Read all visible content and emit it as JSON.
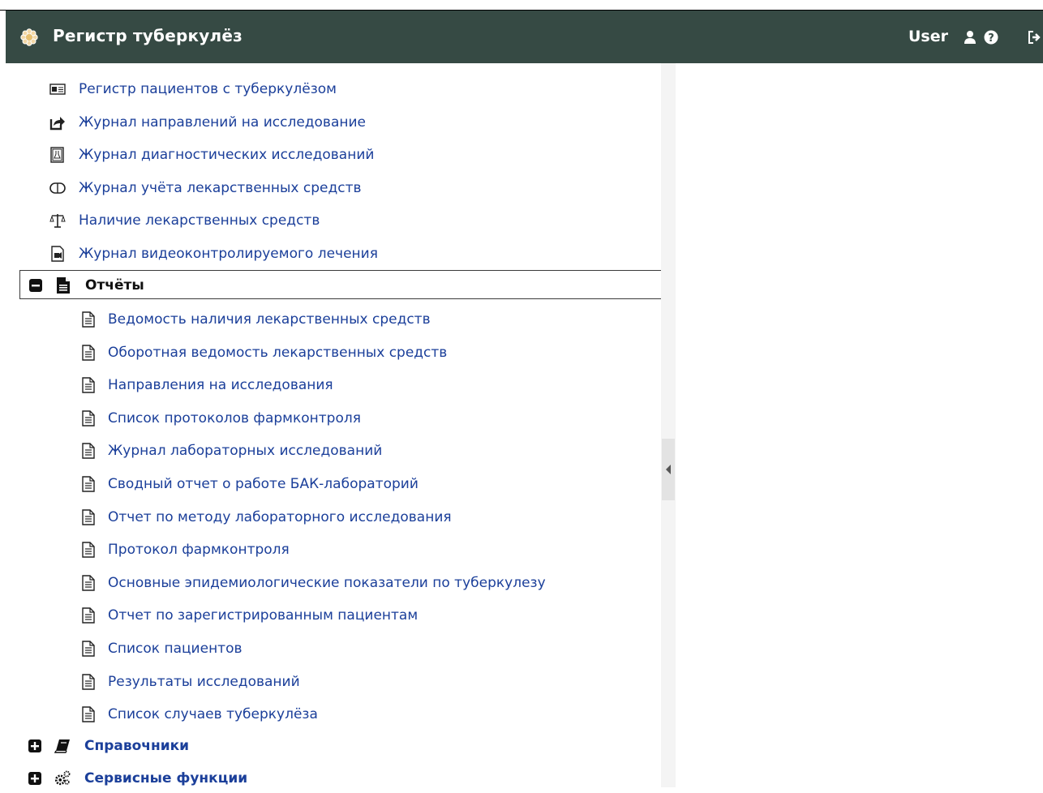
{
  "header": {
    "title": "Регистр туберкулёз",
    "user": "User",
    "bg_color": "#364a44",
    "icons": [
      "flower-logo-icon",
      "user-icon",
      "help-icon",
      "logout-icon"
    ]
  },
  "menu": {
    "top_items": [
      {
        "label": "Регистр пациентов с туберкулёзом",
        "icon": "id-card-icon"
      },
      {
        "label": "Журнал направлений на исследование",
        "icon": "share-icon"
      },
      {
        "label": "Журнал диагностических исследований",
        "icon": "lab-flask-icon"
      },
      {
        "label": "Журнал учёта лекарственных средств",
        "icon": "pill-capsule-icon"
      },
      {
        "label": "Наличие лекарственных средств",
        "icon": "scales-icon"
      },
      {
        "label": "Журнал видеоконтролируемого лечения",
        "icon": "video-file-icon"
      }
    ],
    "reports": {
      "label": "Отчёты",
      "expanded": true,
      "items": [
        "Ведомость наличия лекарственных средств",
        "Оборотная ведомость лекарственных средств",
        "Направления на исследования",
        "Список протоколов фармконтроля",
        "Журнал лабораторных исследований",
        "Сводный отчет о работе БАК-лабораторий",
        "Отчет по методу лабораторного исследования",
        "Протокол фармконтроля",
        "Основные эпидемиологические показатели по туберкулезу",
        "Отчет по зарегистрированным пациентам",
        "Список пациентов",
        "Результаты исследований",
        "Список случаев туберкулёза"
      ]
    },
    "directories": {
      "label": "Справочники",
      "expanded": false
    },
    "service": {
      "label": "Сервисные функции",
      "expanded": false
    }
  },
  "colors": {
    "link": "#1b3f9a",
    "selected_border": "#3a3a3a"
  }
}
